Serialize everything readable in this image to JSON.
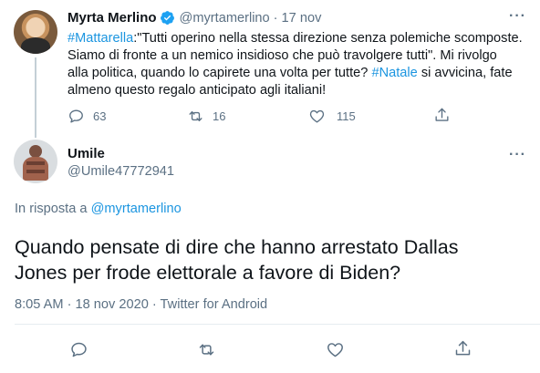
{
  "parent_tweet": {
    "author_name": "Myrta Merlino",
    "handle": "@myrtamerlino",
    "separator": "·",
    "date": "17 nov",
    "more_icon": "more-icon",
    "text_segments": [
      {
        "text": "#Mattarella",
        "link": true
      },
      {
        "text": ":\"Tutti operino nella stessa direzione senza polemiche scomposte.",
        "link": false
      }
    ],
    "line2": "Siamo di fronte a un nemico insidioso che può travolgere tutti\". Mi rivolgo",
    "line3_pre": "alla politica, quando lo capirete una volta per tutte? ",
    "line3_tag": "#Natale",
    "line3_post": " si avvicina, fate",
    "line4": "almeno questo regalo anticipato agli italiani!",
    "actions": {
      "reply_count": "63",
      "retweet_count": "16",
      "like_count": "115"
    }
  },
  "reply_tweet": {
    "author_name": "Umile",
    "handle": "@Umile47772941",
    "in_reply_prefix": "In risposta a ",
    "in_reply_handle": "@myrtamerlino",
    "text_line1": "Quando pensate di dire che hanno arrestato Dallas",
    "text_line2": "Jones per frode elettorale a favore di Biden?",
    "meta": "8:05 AM · 18 nov 2020 · Twitter for Android"
  },
  "colors": {
    "link": "#1b95e0",
    "verified": "#1da1f2",
    "muted": "#5b7083",
    "thread_line": "#c4cfd6"
  }
}
